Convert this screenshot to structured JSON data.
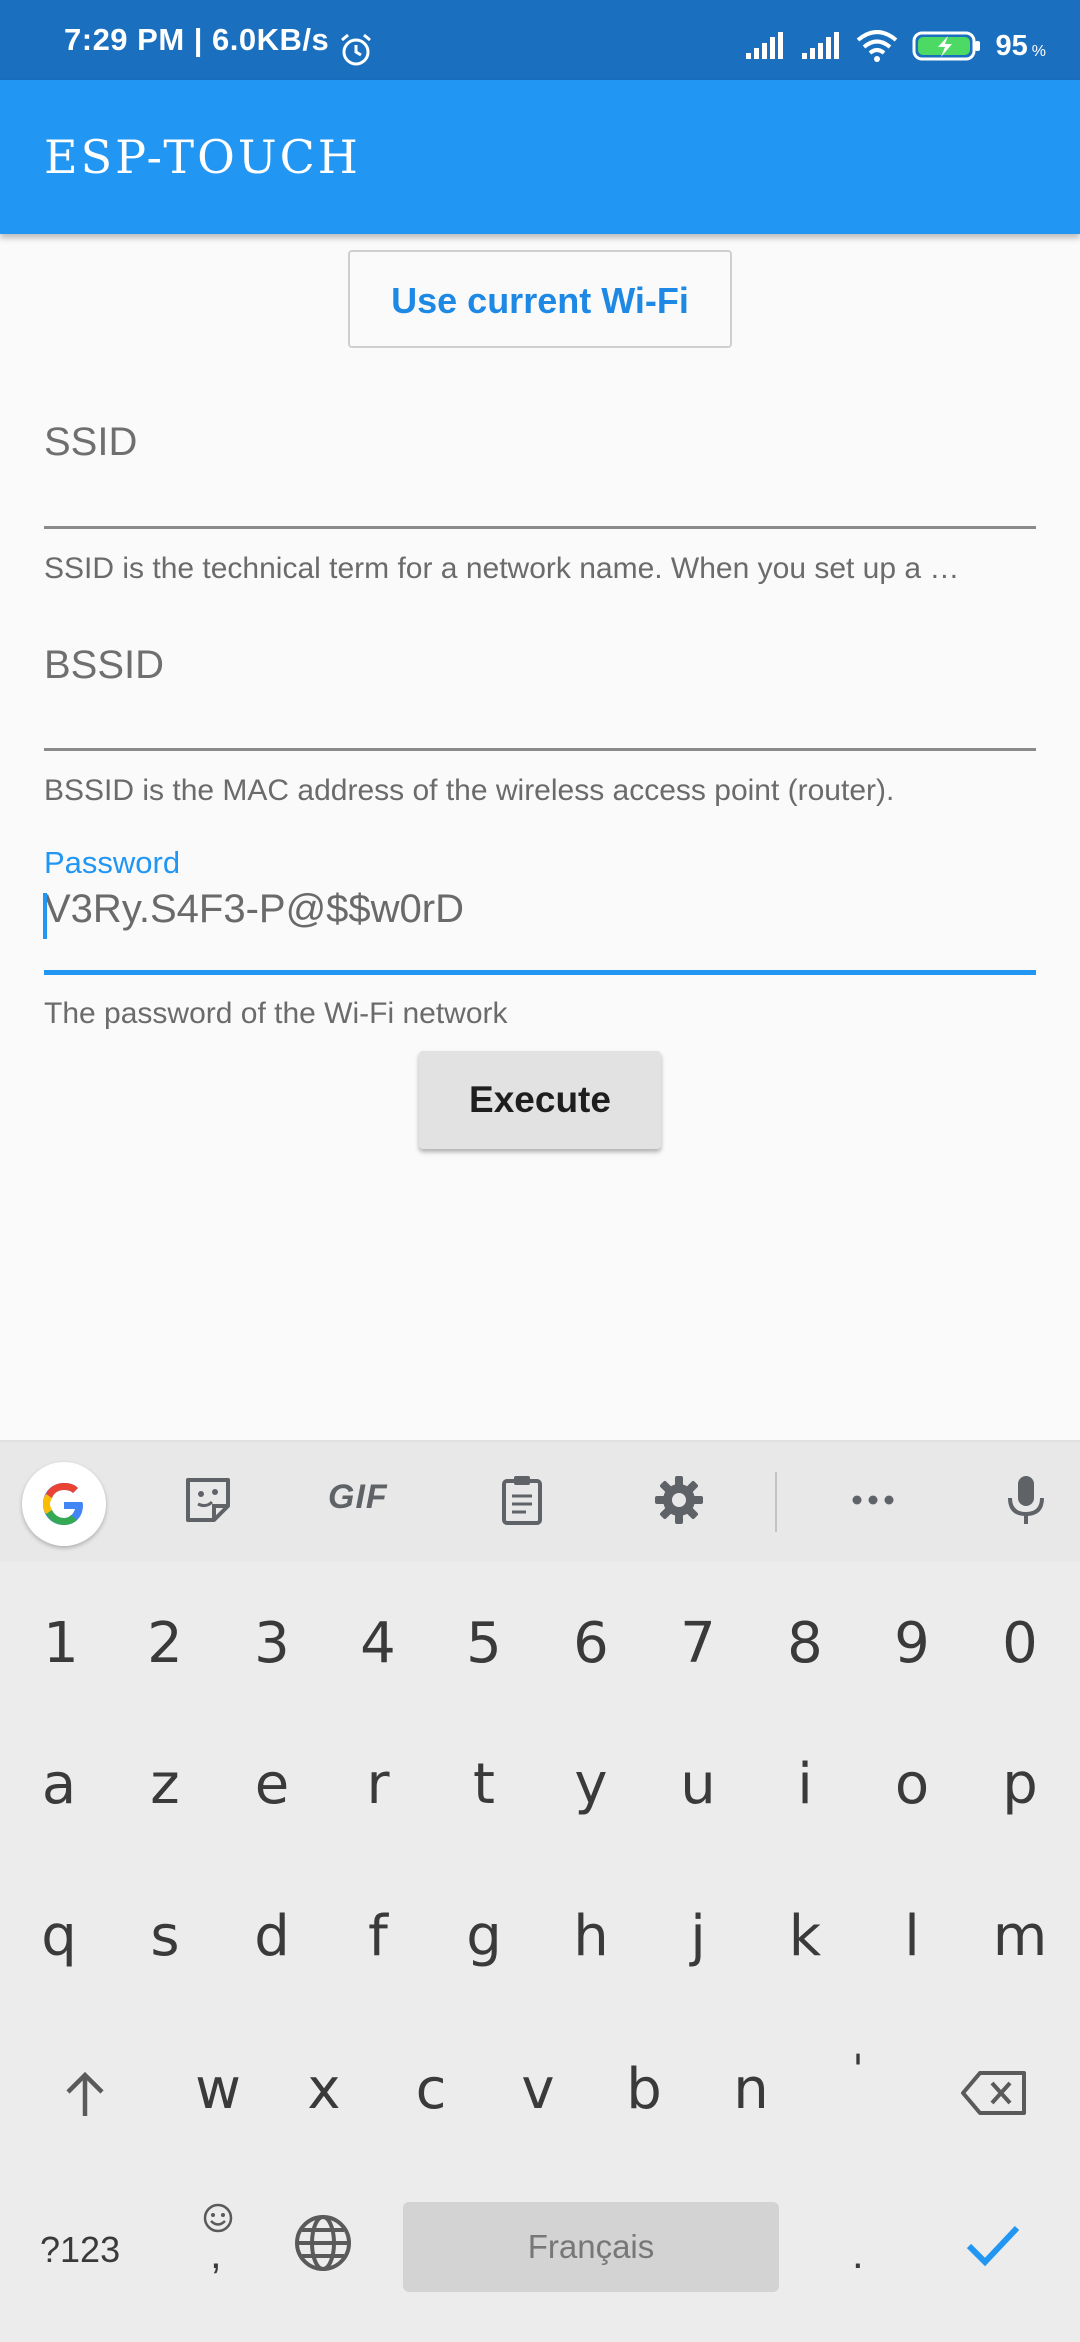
{
  "status_bar": {
    "time": "7:29 PM | 6.0KB/s",
    "battery_percent": "95",
    "battery_unit": "%"
  },
  "app_bar": {
    "title": "ESP-TOUCH"
  },
  "form": {
    "use_wifi_label": "Use current Wi-Fi",
    "ssid": {
      "label": "SSID",
      "helper": "SSID is the technical term for a network name. When you set up a …"
    },
    "bssid": {
      "label": "BSSID",
      "helper": "BSSID is the MAC address of the wireless access point (router)."
    },
    "password": {
      "label": "Password",
      "value": "V3Ry.S4F3-P@$$w0rD",
      "helper": "The password of the Wi-Fi network"
    },
    "execute_label": "Execute"
  },
  "keyboard": {
    "toolbar": {
      "gif_label": "GIF"
    },
    "number_row": [
      "1",
      "2",
      "3",
      "4",
      "5",
      "6",
      "7",
      "8",
      "9",
      "0"
    ],
    "row1": [
      "a",
      "z",
      "e",
      "r",
      "t",
      "y",
      "u",
      "i",
      "o",
      "p"
    ],
    "row2": [
      "q",
      "s",
      "d",
      "f",
      "g",
      "h",
      "j",
      "k",
      "l",
      "m"
    ],
    "row3": [
      "w",
      "x",
      "c",
      "v",
      "b",
      "n",
      "'"
    ],
    "symbols_label": "?123",
    "comma": ",",
    "space_label": "Français",
    "period": ".",
    "accent_color": "#2196f3"
  }
}
